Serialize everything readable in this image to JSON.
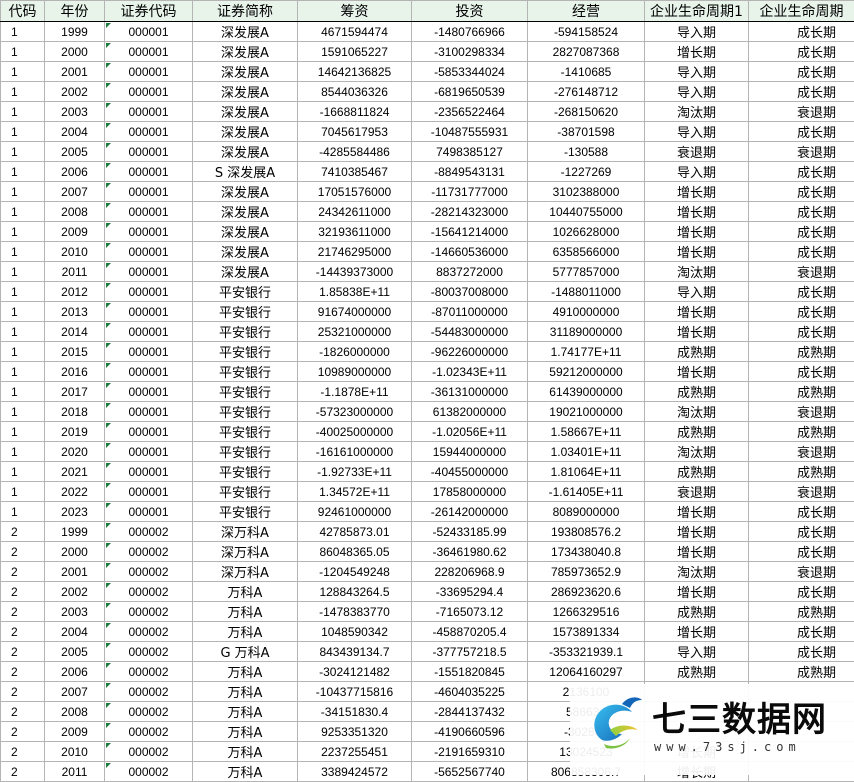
{
  "columns": [
    "代码",
    "年份",
    "证券代码",
    "证券简称",
    "筹资",
    "投资",
    "经营",
    "企业生命周期1",
    "企业生命周期"
  ],
  "rows": [
    [
      "1",
      "1999",
      "000001",
      "深发展A",
      "4671594474",
      "-1480766966",
      "-594158524",
      "导入期",
      "成长期"
    ],
    [
      "1",
      "2000",
      "000001",
      "深发展A",
      "1591065227",
      "-3100298334",
      "2827087368",
      "增长期",
      "成长期"
    ],
    [
      "1",
      "2001",
      "000001",
      "深发展A",
      "14642136825",
      "-5853344024",
      "-1410685",
      "导入期",
      "成长期"
    ],
    [
      "1",
      "2002",
      "000001",
      "深发展A",
      "8544036326",
      "-6819650539",
      "-276148712",
      "导入期",
      "成长期"
    ],
    [
      "1",
      "2003",
      "000001",
      "深发展A",
      "-1668811824",
      "-2356522464",
      "-268150620",
      "淘汰期",
      "衰退期"
    ],
    [
      "1",
      "2004",
      "000001",
      "深发展A",
      "7045617953",
      "-10487555931",
      "-38701598",
      "导入期",
      "成长期"
    ],
    [
      "1",
      "2005",
      "000001",
      "深发展A",
      "-4285584486",
      "7498385127",
      "-130588",
      "衰退期",
      "衰退期"
    ],
    [
      "1",
      "2006",
      "000001",
      "S 深发展A",
      "7410385467",
      "-8849543131",
      "-1227269",
      "导入期",
      "成长期"
    ],
    [
      "1",
      "2007",
      "000001",
      "深发展A",
      "17051576000",
      "-11731777000",
      "3102388000",
      "增长期",
      "成长期"
    ],
    [
      "1",
      "2008",
      "000001",
      "深发展A",
      "24342611000",
      "-28214323000",
      "10440755000",
      "增长期",
      "成长期"
    ],
    [
      "1",
      "2009",
      "000001",
      "深发展A",
      "32193611000",
      "-15641214000",
      "1026628000",
      "增长期",
      "成长期"
    ],
    [
      "1",
      "2010",
      "000001",
      "深发展A",
      "21746295000",
      "-14660536000",
      "6358566000",
      "增长期",
      "成长期"
    ],
    [
      "1",
      "2011",
      "000001",
      "深发展A",
      "-14439373000",
      "8837272000",
      "5777857000",
      "淘汰期",
      "衰退期"
    ],
    [
      "1",
      "2012",
      "000001",
      "平安银行",
      "1.85838E+11",
      "-80037008000",
      "-1488011000",
      "导入期",
      "成长期"
    ],
    [
      "1",
      "2013",
      "000001",
      "平安银行",
      "91674000000",
      "-87011000000",
      "4910000000",
      "增长期",
      "成长期"
    ],
    [
      "1",
      "2014",
      "000001",
      "平安银行",
      "25321000000",
      "-54483000000",
      "31189000000",
      "增长期",
      "成长期"
    ],
    [
      "1",
      "2015",
      "000001",
      "平安银行",
      "-1826000000",
      "-96226000000",
      "1.74177E+11",
      "成熟期",
      "成熟期"
    ],
    [
      "1",
      "2016",
      "000001",
      "平安银行",
      "10989000000",
      "-1.02343E+11",
      "59212000000",
      "增长期",
      "成长期"
    ],
    [
      "1",
      "2017",
      "000001",
      "平安银行",
      "-1.1878E+11",
      "-36131000000",
      "61439000000",
      "成熟期",
      "成熟期"
    ],
    [
      "1",
      "2018",
      "000001",
      "平安银行",
      "-57323000000",
      "61382000000",
      "19021000000",
      "淘汰期",
      "衰退期"
    ],
    [
      "1",
      "2019",
      "000001",
      "平安银行",
      "-40025000000",
      "-1.02056E+11",
      "1.58667E+11",
      "成熟期",
      "成熟期"
    ],
    [
      "1",
      "2020",
      "000001",
      "平安银行",
      "-16161000000",
      "15944000000",
      "1.03401E+11",
      "淘汰期",
      "衰退期"
    ],
    [
      "1",
      "2021",
      "000001",
      "平安银行",
      "-1.92733E+11",
      "-40455000000",
      "1.81064E+11",
      "成熟期",
      "成熟期"
    ],
    [
      "1",
      "2022",
      "000001",
      "平安银行",
      "1.34572E+11",
      "17858000000",
      "-1.61405E+11",
      "衰退期",
      "衰退期"
    ],
    [
      "1",
      "2023",
      "000001",
      "平安银行",
      "92461000000",
      "-26142000000",
      "8089000000",
      "增长期",
      "成长期"
    ],
    [
      "2",
      "1999",
      "000002",
      "深万科A",
      "42785873.01",
      "-52433185.99",
      "193808576.2",
      "增长期",
      "成长期"
    ],
    [
      "2",
      "2000",
      "000002",
      "深万科A",
      "86048365.05",
      "-36461980.62",
      "173438040.8",
      "增长期",
      "成长期"
    ],
    [
      "2",
      "2001",
      "000002",
      "深万科A",
      "-1204549248",
      "228206968.9",
      "785973652.9",
      "淘汰期",
      "衰退期"
    ],
    [
      "2",
      "2002",
      "000002",
      "万科A",
      "128843264.5",
      "-33695294.4",
      "286923620.6",
      "增长期",
      "成长期"
    ],
    [
      "2",
      "2003",
      "000002",
      "万科A",
      "-1478383770",
      "-7165073.12",
      "1266329516",
      "成熟期",
      "成熟期"
    ],
    [
      "2",
      "2004",
      "000002",
      "万科A",
      "1048590342",
      "-458870205.4",
      "1573891334",
      "增长期",
      "成长期"
    ],
    [
      "2",
      "2005",
      "000002",
      "G 万科A",
      "843439134.7",
      "-377757218.5",
      "-353321939.1",
      "导入期",
      "成长期"
    ],
    [
      "2",
      "2006",
      "000002",
      "万科A",
      "-3024121482",
      "-1551820845",
      "12064160297",
      "成熟期",
      "成熟期"
    ],
    [
      "2",
      "2007",
      "000002",
      "万科A",
      "-10437715816",
      "-4604035225",
      "2136100",
      "",
      ""
    ],
    [
      "2",
      "2008",
      "000002",
      "万科A",
      "-34151830.4",
      "-2844137432",
      "586634",
      "",
      ""
    ],
    [
      "2",
      "2009",
      "000002",
      "万科A",
      "9253351320",
      "-4190660596",
      "-302865",
      "",
      ""
    ],
    [
      "2",
      "2010",
      "000002",
      "万科A",
      "2237255451",
      "-2191659310",
      "13024523",
      "增长期",
      ""
    ],
    [
      "2",
      "2011",
      "000002",
      "万科A",
      "3389424572",
      "-5652567740",
      "806858306.7",
      "增长期",
      ""
    ]
  ],
  "watermark": {
    "title": "七三数据网",
    "url": "www.73sj.com"
  },
  "colors": {
    "header_bg": "#e8f4ea",
    "grid": "#b4b4b4",
    "cell_marker": "#1f7a3d"
  }
}
